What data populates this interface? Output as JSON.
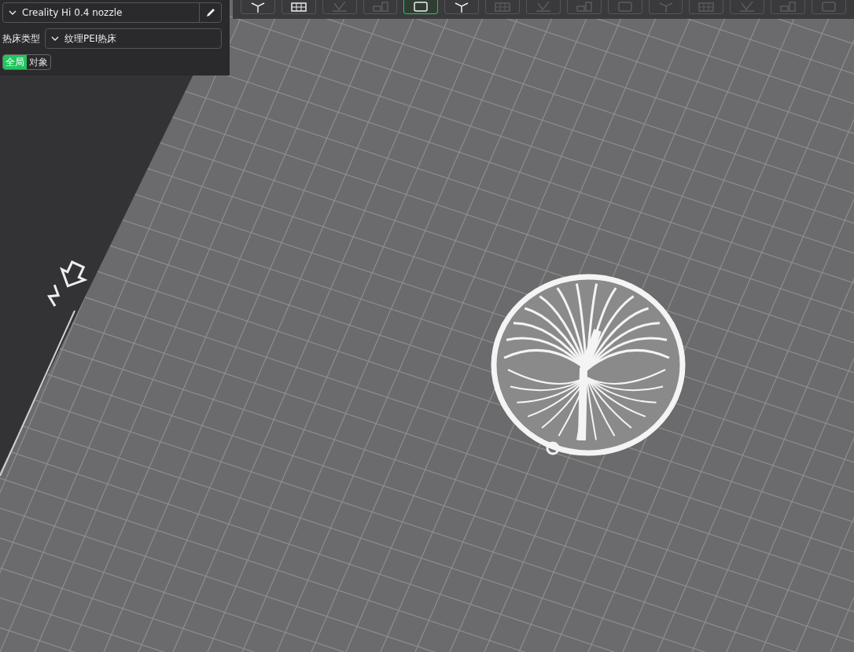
{
  "printer": {
    "name": "Creality Hi 0.4 nozzle"
  },
  "bed": {
    "label": "热床类型",
    "value": "纹理PEI热床"
  },
  "scope_tabs": [
    {
      "label": "全局",
      "selected": true
    },
    {
      "label": "对象",
      "selected": false
    }
  ],
  "toolbar": [
    {
      "selected": false,
      "disabled": false
    },
    {
      "selected": false,
      "disabled": false
    },
    {
      "selected": false,
      "disabled": true
    },
    {
      "selected": false,
      "disabled": true
    },
    {
      "selected": true,
      "disabled": false
    },
    {
      "selected": false,
      "disabled": false
    },
    {
      "selected": false,
      "disabled": true
    },
    {
      "selected": false,
      "disabled": true
    },
    {
      "selected": false,
      "disabled": true
    },
    {
      "selected": false,
      "disabled": true
    },
    {
      "selected": false,
      "disabled": true
    },
    {
      "selected": false,
      "disabled": true
    },
    {
      "selected": false,
      "disabled": true
    },
    {
      "selected": false,
      "disabled": true
    },
    {
      "selected": false,
      "disabled": true
    }
  ]
}
